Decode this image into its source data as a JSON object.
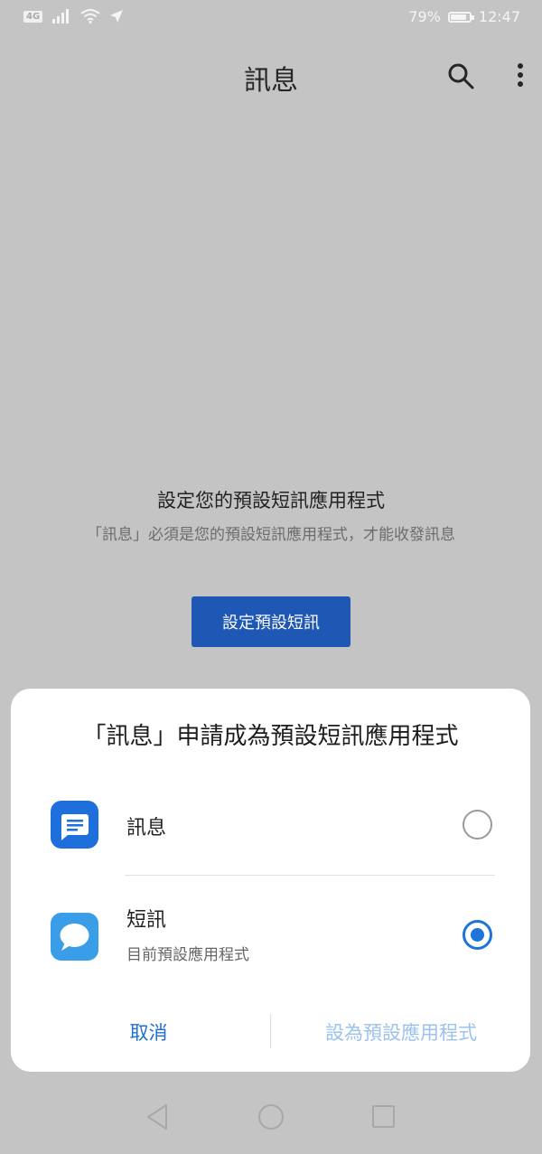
{
  "status_bar": {
    "network_badge": "4G",
    "battery": "79%",
    "battery_level": 0.79,
    "time": "12:47"
  },
  "app_bar": {
    "title": "訊息",
    "search_icon": "search-icon",
    "more_icon": "more-vertical-icon"
  },
  "empty_state": {
    "title": "設定您的預設短訊應用程式",
    "body": "「訊息」必須是您的預設短訊應用程式，才能收發訊息",
    "button_label": "設定預設短訊"
  },
  "dialog": {
    "title": "「訊息」申請成為預設短訊應用程式",
    "options": [
      {
        "label": "訊息",
        "subtitle": "",
        "icon": "messages-app-icon",
        "selected": false
      },
      {
        "label": "短訊",
        "subtitle": "目前預設應用程式",
        "icon": "sms-app-icon",
        "selected": true
      }
    ],
    "cancel_label": "取消",
    "confirm_label": "設為預設應用程式"
  },
  "colors": {
    "accent": "#1e74d9",
    "primary_button": "#1e58b4",
    "disabled_action": "#9cc2ec",
    "scrim": "#c4c4c4"
  },
  "nav_bar": {
    "back_icon": "back-triangle-icon",
    "home_icon": "home-circle-icon",
    "recents_icon": "recents-square-icon"
  }
}
